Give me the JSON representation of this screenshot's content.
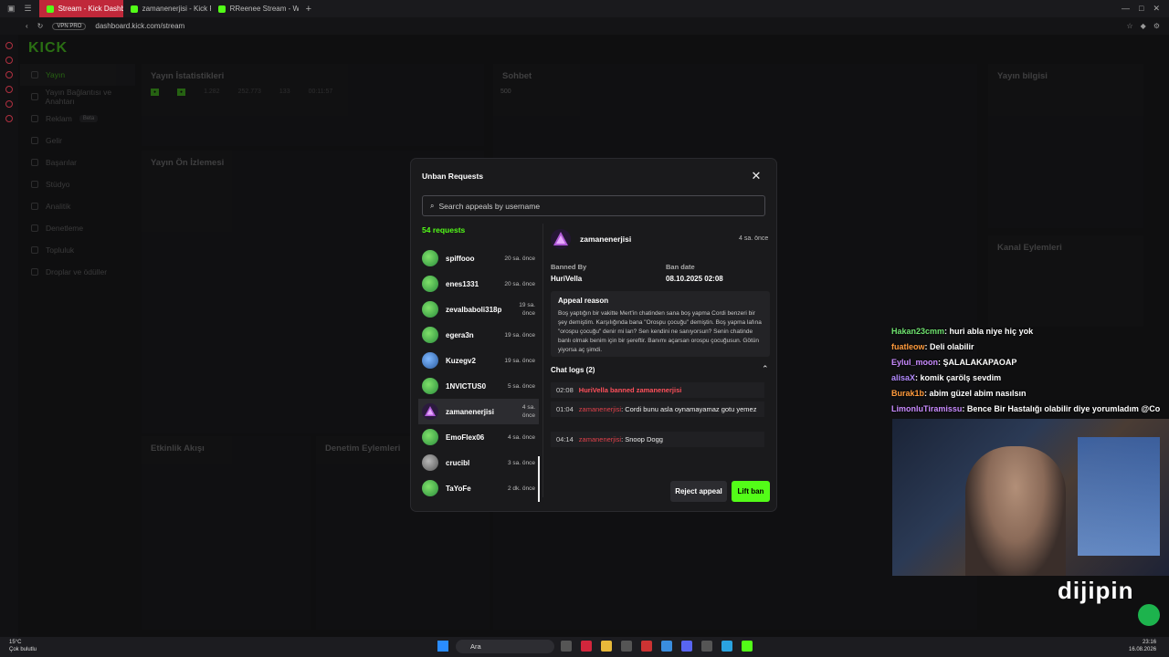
{
  "browser": {
    "tabs": [
      {
        "label": "Stream - Kick Dashboard",
        "active": true
      },
      {
        "label": "zamanenerjisi - Kick Profili",
        "active": false
      },
      {
        "label": "RReenee Stream - Watch L",
        "active": false
      }
    ],
    "vpn_label": "VPN PRO",
    "url": "dashboard.kick.com/stream"
  },
  "dashboard": {
    "logo": "KICK",
    "nav": [
      "Yayın",
      "Yayın Bağlantısı ve Anahtarı",
      "Reklam",
      "Gelir",
      "Başarılar",
      "Stüdyo",
      "Analitik",
      "Denetleme",
      "Topluluk",
      "Droplar ve ödüller"
    ],
    "nav_badge": "Beta",
    "panels": {
      "stats": "Yayın İstatistikleri",
      "preview": "Yayın Ön İzlemesi",
      "chat": "Sohbet",
      "info": "Yayın bilgisi",
      "activity": "Etkinlik Akışı",
      "moderation": "Denetim Eylemleri",
      "channel": "Kanal Eylemleri"
    },
    "stats_values": [
      "1.282",
      "252.773",
      "133",
      "00:11:57"
    ],
    "chat_counter": "500"
  },
  "side_chat": [
    {
      "user": "Hakan23cmm",
      "color": "#6fe36f",
      "msg": ": huri abla niye hiç yok"
    },
    {
      "user": "fuatleow",
      "color": "#ff9b3d",
      "msg": ": Deli olabilir"
    },
    {
      "user": "Eylul_moon",
      "color": "#c98bff",
      "msg": ": ŞALALAKAPAOAP"
    },
    {
      "user": "alisaX",
      "color": "#b38bff",
      "msg": ": komik çarölş sevdim"
    },
    {
      "user": "Burak1b",
      "color": "#ff9b3d",
      "msg": ": abim güzel abim nasılsın"
    },
    {
      "user": "LimonluTiramissu",
      "color": "#c98bff",
      "msg": ": Bence Bir Hastalığı olabilir diye yorumladım @Co"
    }
  ],
  "brand": {
    "main": "dijipin"
  },
  "modal": {
    "title": "Unban Requests",
    "search_placeholder": "Search appeals by username",
    "request_count": "54 requests",
    "requests": [
      {
        "name": "spiffooo",
        "time": "20 sa. önce",
        "avatar": "green"
      },
      {
        "name": "enes1331",
        "time": "20 sa. önce",
        "avatar": "green"
      },
      {
        "name": "zevalbaboli318p",
        "time": "19 sa. önce",
        "avatar": "green"
      },
      {
        "name": "egera3n",
        "time": "19 sa. önce",
        "avatar": "green"
      },
      {
        "name": "Kuzegv2",
        "time": "19 sa. önce",
        "avatar": "blue"
      },
      {
        "name": "1NVICTUS0",
        "time": "5 sa. önce",
        "avatar": "green"
      },
      {
        "name": "zamanenerjisi",
        "time": "4 sa. önce",
        "avatar": "tri",
        "selected": true
      },
      {
        "name": "EmoFlex06",
        "time": "4 sa. önce",
        "avatar": "green"
      },
      {
        "name": "crucibl",
        "time": "3 sa. önce",
        "avatar": "grey"
      },
      {
        "name": "TaYoFe",
        "time": "2 dk. önce",
        "avatar": "green"
      }
    ],
    "detail": {
      "username": "zamanenerjisi",
      "time": "4 sa. önce",
      "banned_by_label": "Banned By",
      "banned_by": "HuriVella",
      "ban_date_label": "Ban date",
      "ban_date": "08.10.2025 02:08",
      "appeal_reason_label": "Appeal reason",
      "appeal_reason": "Boş yaptığın bir vakitte Mert'in chatinden sana boş yapma Cordi benzeri bir şey demiştim. Karşılığında bana \"Orospu çocuğu\" demiştin. Boş yapma lafına \"orospu çocuğu\" denir mi lan? Sen kendini ne sanıyorsun? Senin chatinde banlı olmak benim için bir şereftir. Banımı açarsan orospu çocuğusun. Götün yiyorsa aç şimdi.",
      "chat_logs_label": "Chat logs (2)",
      "chat_logs": [
        {
          "time": "02:08",
          "user": "",
          "text": "HuriVella banned zamanenerjisi",
          "system": true
        },
        {
          "time": "01:04",
          "user": "zamanenerjisi",
          "text": ": Cordi bunu asla oynamayamaz gotu yemez",
          "system": false
        },
        {
          "time": "04:14",
          "user": "zamanenerjisi",
          "text": ": Snoop Dogg",
          "system": false
        }
      ]
    },
    "reject_label": "Reject appeal",
    "lift_label": "Lift ban"
  },
  "taskbar": {
    "weather_temp": "15°C",
    "weather_desc": "Çok bulutlu",
    "search_label": "Ara",
    "time": "23:16",
    "date": "16.08.2026"
  }
}
